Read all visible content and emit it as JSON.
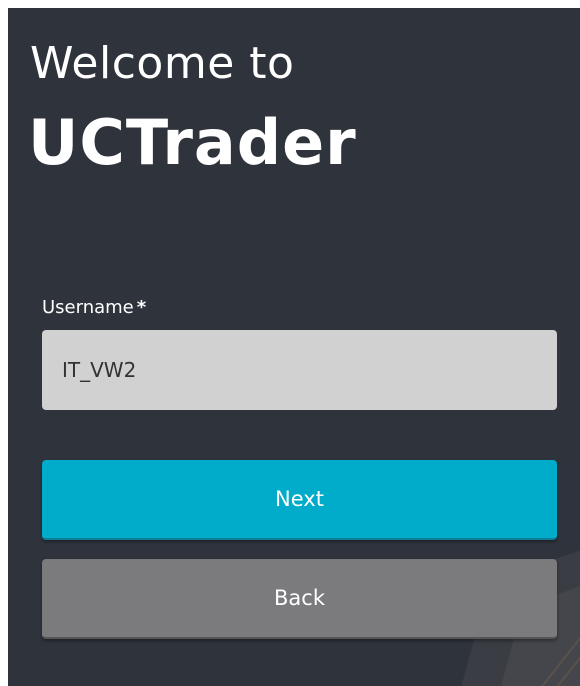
{
  "login": {
    "welcome_text": "Welcome to",
    "brand_name": "UCTrader",
    "username_label": "Username",
    "required_marker": "*",
    "username_value": "IT_VW2",
    "next_label": "Next",
    "back_label": "Back"
  },
  "colors": {
    "panel_background": "#2f333c",
    "input_background": "#d1d1d1",
    "next_button": "#00acc9",
    "back_button": "#7b7b7d"
  }
}
